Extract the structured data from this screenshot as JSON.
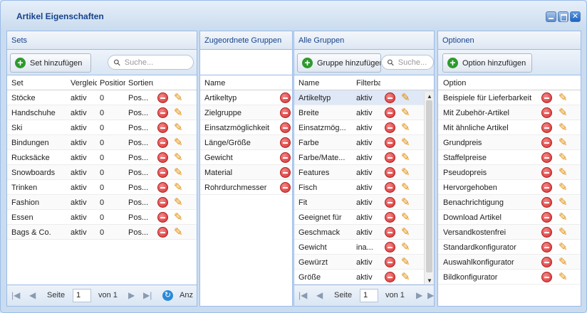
{
  "window": {
    "title": "Artikel Eigenschaften"
  },
  "sets": {
    "header": "Sets",
    "add_button": "Set hinzufügen",
    "search_placeholder": "Suche...",
    "columns": [
      "Set",
      "Vergleich",
      "Position",
      "Sortierung"
    ],
    "rows": [
      {
        "name": "Stöcke",
        "cmp": "aktiv",
        "pos": "0",
        "sort": "Pos..."
      },
      {
        "name": "Handschuhe",
        "cmp": "aktiv",
        "pos": "0",
        "sort": "Pos..."
      },
      {
        "name": "Ski",
        "cmp": "aktiv",
        "pos": "0",
        "sort": "Pos..."
      },
      {
        "name": "Bindungen",
        "cmp": "aktiv",
        "pos": "0",
        "sort": "Pos..."
      },
      {
        "name": "Rucksäcke",
        "cmp": "aktiv",
        "pos": "0",
        "sort": "Pos..."
      },
      {
        "name": "Snowboards",
        "cmp": "aktiv",
        "pos": "0",
        "sort": "Pos..."
      },
      {
        "name": "Trinken",
        "cmp": "aktiv",
        "pos": "0",
        "sort": "Pos..."
      },
      {
        "name": "Fashion",
        "cmp": "aktiv",
        "pos": "0",
        "sort": "Pos..."
      },
      {
        "name": "Essen",
        "cmp": "aktiv",
        "pos": "0",
        "sort": "Pos..."
      },
      {
        "name": "Bags & Co.",
        "cmp": "aktiv",
        "pos": "0",
        "sort": "Pos..."
      }
    ],
    "pager": {
      "page_label": "Seite",
      "page": "1",
      "of_label": "von 1",
      "display_label": "Anz"
    }
  },
  "assigned": {
    "header": "Zugeordnete Gruppen",
    "column": "Name",
    "rows": [
      "Artikeltyp",
      "Zielgruppe",
      "Einsatzmöglichkeit",
      "Länge/Größe",
      "Gewicht",
      "Material",
      "Rohrdurchmesser"
    ]
  },
  "groups": {
    "header": "Alle Gruppen",
    "add_button": "Gruppe hinzufügen",
    "search_placeholder": "Suche...",
    "columns": [
      "Name",
      "Filterbar"
    ],
    "rows": [
      {
        "name": "Artikeltyp",
        "filter": "aktiv"
      },
      {
        "name": "Breite",
        "filter": "aktiv"
      },
      {
        "name": "Einsatzmög...",
        "filter": "aktiv"
      },
      {
        "name": "Farbe",
        "filter": "aktiv"
      },
      {
        "name": "Farbe/Mate...",
        "filter": "aktiv"
      },
      {
        "name": "Features",
        "filter": "aktiv"
      },
      {
        "name": "Fisch",
        "filter": "aktiv"
      },
      {
        "name": "Fit",
        "filter": "aktiv"
      },
      {
        "name": "Geeignet für",
        "filter": "aktiv"
      },
      {
        "name": "Geschmack",
        "filter": "aktiv"
      },
      {
        "name": "Gewicht",
        "filter": "ina..."
      },
      {
        "name": "Gewürzt",
        "filter": "aktiv"
      },
      {
        "name": "Größe",
        "filter": "aktiv"
      }
    ],
    "pager": {
      "page_label": "Seite",
      "page": "1",
      "of_label": "von 1"
    }
  },
  "options": {
    "header": "Optionen",
    "add_button": "Option hinzufügen",
    "column": "Option",
    "rows": [
      "Beispiele für Lieferbarkeit",
      "Mit Zubehör-Artikel",
      "Mit ähnliche Artikel",
      "Grundpreis",
      "Staffelpreise",
      "Pseudopreis",
      "Hervorgehoben",
      "Benachrichtigung",
      "Download Artikel",
      "Versandkostenfrei",
      "Standardkonfigurator",
      "Auswahlkonfigurator",
      "Bildkonfigurator"
    ]
  }
}
